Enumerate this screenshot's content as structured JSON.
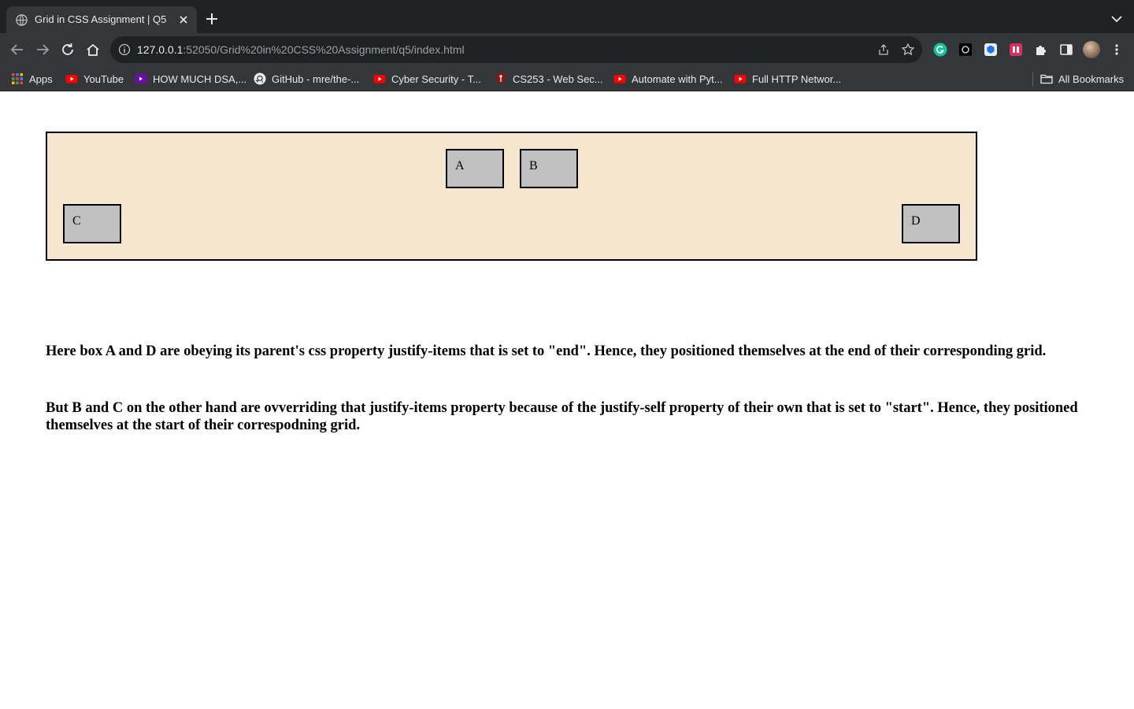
{
  "browser": {
    "tab": {
      "title": "Grid in CSS Assignment | Q5"
    },
    "url": {
      "host": "127.0.0.1",
      "path": ":52050/Grid%20in%20CSS%20Assignment/q5/index.html"
    },
    "bookmarks": [
      {
        "label": "Apps",
        "icon": "apps-grid-icon"
      },
      {
        "label": "YouTube",
        "icon": "youtube-icon"
      },
      {
        "label": "HOW MUCH DSA,...",
        "icon": "video-icon"
      },
      {
        "label": "GitHub - mre/the-...",
        "icon": "github-icon"
      },
      {
        "label": "Cyber Security - T...",
        "icon": "youtube-icon"
      },
      {
        "label": "CS253 - Web Sec...",
        "icon": "stanford-icon"
      },
      {
        "label": "Automate with Pyt...",
        "icon": "youtube-icon"
      },
      {
        "label": "Full HTTP Networ...",
        "icon": "youtube-icon"
      }
    ],
    "all_bookmarks_label": "All Bookmarks"
  },
  "page": {
    "boxes": {
      "a": "A",
      "b": "B",
      "c": "C",
      "d": "D"
    },
    "paragraphs": [
      "Here box A and D are obeying its parent's css property justify-items that is set to \"end\". Hence, they positioned themselves at the end of their corresponding grid.",
      "But B and C on the other hand are ovverriding that justify-items property because of the justify-self property of their own that is set to \"start\". Hence, they positioned themselves at the start of their correspodning grid."
    ]
  },
  "colors": {
    "grid_background": "#f7e6cf",
    "box_background": "#c0c0c0",
    "chrome_dark": "#202124",
    "chrome_toolbar": "#35363a"
  }
}
